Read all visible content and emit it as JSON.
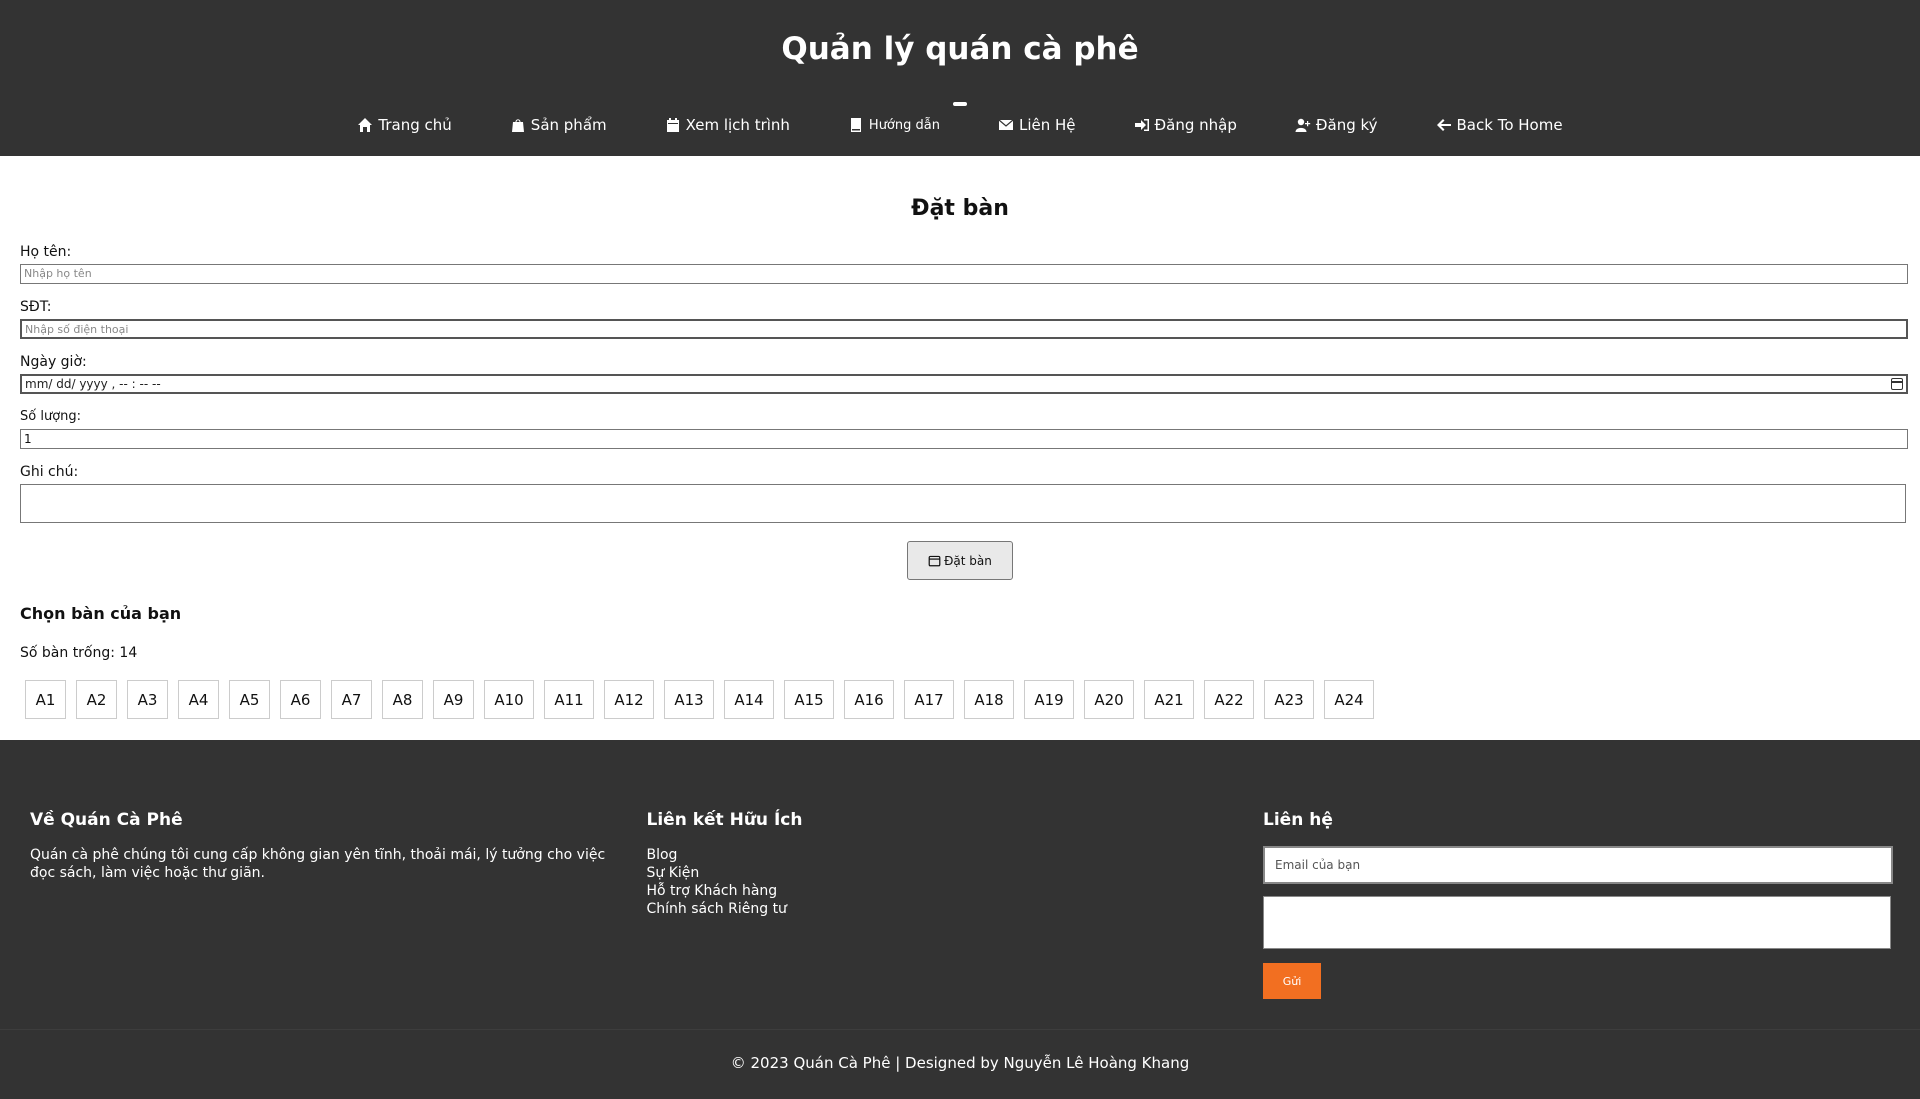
{
  "header": {
    "site_title": "Quản lý quán cà phê",
    "nav": [
      {
        "label": "Trang chủ",
        "icon": "home-icon"
      },
      {
        "label": "Sản phẩm",
        "icon": "shopping-bag-icon"
      },
      {
        "label": "Xem lịch trình",
        "icon": "calendar-icon"
      },
      {
        "label": "Hướng dẫn",
        "icon": "book-icon"
      },
      {
        "label": "Liên Hệ",
        "icon": "envelope-icon"
      },
      {
        "label": "Đăng nhập",
        "icon": "sign-in-icon"
      },
      {
        "label": "Đăng ký",
        "icon": "user-plus-icon"
      },
      {
        "label": "Back To Home",
        "icon": "arrow-left-icon"
      }
    ]
  },
  "form": {
    "title": "Đặt bàn",
    "name_label": "Họ tên:",
    "name_placeholder": "Nhập họ tên",
    "phone_label": "SĐT:",
    "phone_placeholder": "Nhập số điện thoại",
    "datetime_label": "Ngày giờ:",
    "datetime_value": "mm/ dd/ yyyy ,   -- : --  --",
    "quantity_label": "Số lượng:",
    "quantity_value": "1",
    "note_label": "Ghi chú:",
    "submit_label": "Đặt bàn"
  },
  "tables": {
    "title": "Chọn bàn của bạn",
    "available_text": "Số bàn trống: 14",
    "items": [
      "A1",
      "A2",
      "A3",
      "A4",
      "A5",
      "A6",
      "A7",
      "A8",
      "A9",
      "A10",
      "A11",
      "A12",
      "A13",
      "A14",
      "A15",
      "A16",
      "A17",
      "A18",
      "A19",
      "A20",
      "A21",
      "A22",
      "A23",
      "A24"
    ]
  },
  "footer": {
    "about_title": "Về Quán Cà Phê",
    "about_text": "Quán cà phê chúng tôi cung cấp không gian yên tĩnh, thoải mái, lý tưởng cho việc đọc sách, làm việc hoặc thư giãn.",
    "links_title": "Liên kết Hữu Ích",
    "links": [
      "Blog",
      "Sự Kiện",
      "Hỗ trợ Khách hàng",
      "Chính sách Riêng tư"
    ],
    "contact_title": "Liên hệ",
    "email_placeholder": "Email của bạn",
    "send_label": "Gửi",
    "copyright": "© 2023 Quán Cà Phê | Designed by Nguyễn Lê Hoàng Khang"
  },
  "colors": {
    "header_bg": "#333333",
    "footer_bg": "#333333",
    "accent": "#f26f21"
  }
}
